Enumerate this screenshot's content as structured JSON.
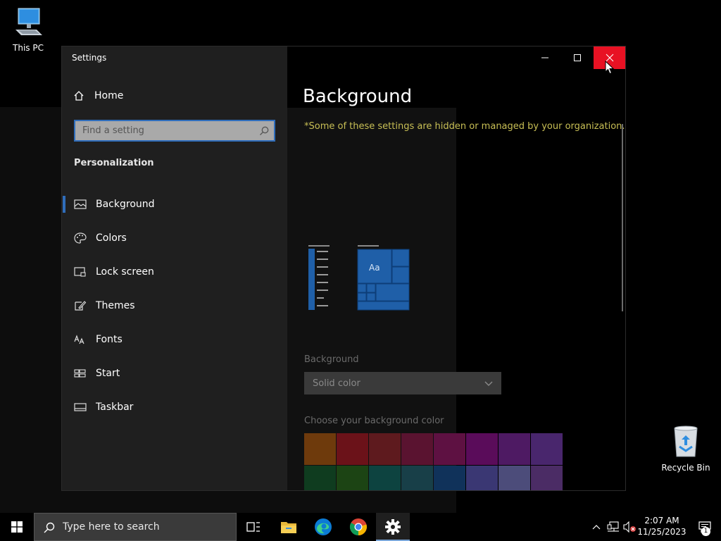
{
  "desktop": {
    "icons": [
      {
        "label": "This PC"
      },
      {
        "label": "Recycle Bin"
      }
    ]
  },
  "window": {
    "title": "Settings",
    "controls": {
      "minimize": "minimize-icon",
      "maximize": "maximize-icon",
      "close": "close-icon"
    }
  },
  "sidebar": {
    "home_label": "Home",
    "search_placeholder": "Find a setting",
    "section_label": "Personalization",
    "items": [
      {
        "label": "Background",
        "icon": "picture-icon",
        "active": true
      },
      {
        "label": "Colors",
        "icon": "palette-icon"
      },
      {
        "label": "Lock screen",
        "icon": "lock-screen-icon"
      },
      {
        "label": "Themes",
        "icon": "themes-icon"
      },
      {
        "label": "Fonts",
        "icon": "fonts-icon"
      },
      {
        "label": "Start",
        "icon": "start-icon"
      },
      {
        "label": "Taskbar",
        "icon": "taskbar-icon"
      }
    ]
  },
  "content": {
    "title": "Background",
    "notice": "*Some of these settings are hidden or managed by your organization.",
    "preview_text": "Aa",
    "background_label": "Background",
    "background_value": "Solid color",
    "color_label": "Choose your background color",
    "swatch_colors": [
      "#6e3a0c",
      "#6b1219",
      "#5e1a1e",
      "#5a1330",
      "#5e1142",
      "#5a0c5a",
      "#4e1a63",
      "#49266d",
      "#0f3c1f",
      "#1c4414",
      "#0d4340",
      "#183f48",
      "#10325a",
      "#3a3773",
      "#4c4c7a",
      "#4b2c65"
    ],
    "accent_color": "#1f5fa8",
    "highlight_color": "#2f6dbb",
    "notice_color": "#c8bf55"
  },
  "taskbar": {
    "search_placeholder": "Type here to search",
    "apps": [
      "task-view-icon",
      "file-explorer-icon",
      "edge-icon",
      "chrome-icon",
      "settings-icon"
    ],
    "time": "2:07 AM",
    "date": "11/25/2023",
    "notification_count": "1"
  }
}
